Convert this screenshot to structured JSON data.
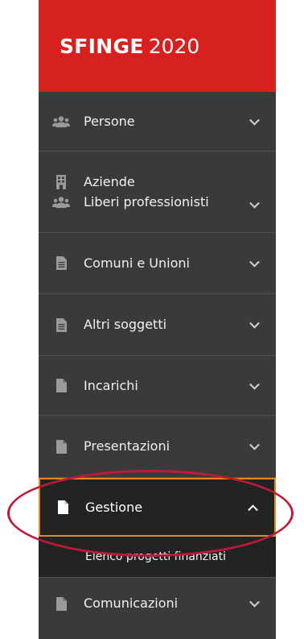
{
  "brand": {
    "name": "SFINGE",
    "year": "2020"
  },
  "menu": [
    {
      "icon": "users-icon",
      "label": "Persone"
    },
    {
      "icon": "building-icon",
      "label": "Aziende",
      "icon2": "users-icon",
      "label2": "Liberi professionisti"
    },
    {
      "icon": "document-icon",
      "label": "Comuni e Unioni"
    },
    {
      "icon": "document-icon",
      "label": "Altri soggetti"
    },
    {
      "icon": "file-icon",
      "label": "Incarichi"
    },
    {
      "icon": "file-icon",
      "label": "Presentazioni"
    },
    {
      "icon": "file-icon",
      "label": "Gestione",
      "expanded": true,
      "submenu": [
        "Elenco progetti finanziati"
      ]
    },
    {
      "icon": "file-icon",
      "label": "Comunicazioni"
    }
  ],
  "colors": {
    "brand_red": "#d7211f",
    "sidebar_bg": "#3a3a3a",
    "active_bg": "#232323",
    "active_border": "#e48a1a",
    "annotation": "#c0183a"
  }
}
